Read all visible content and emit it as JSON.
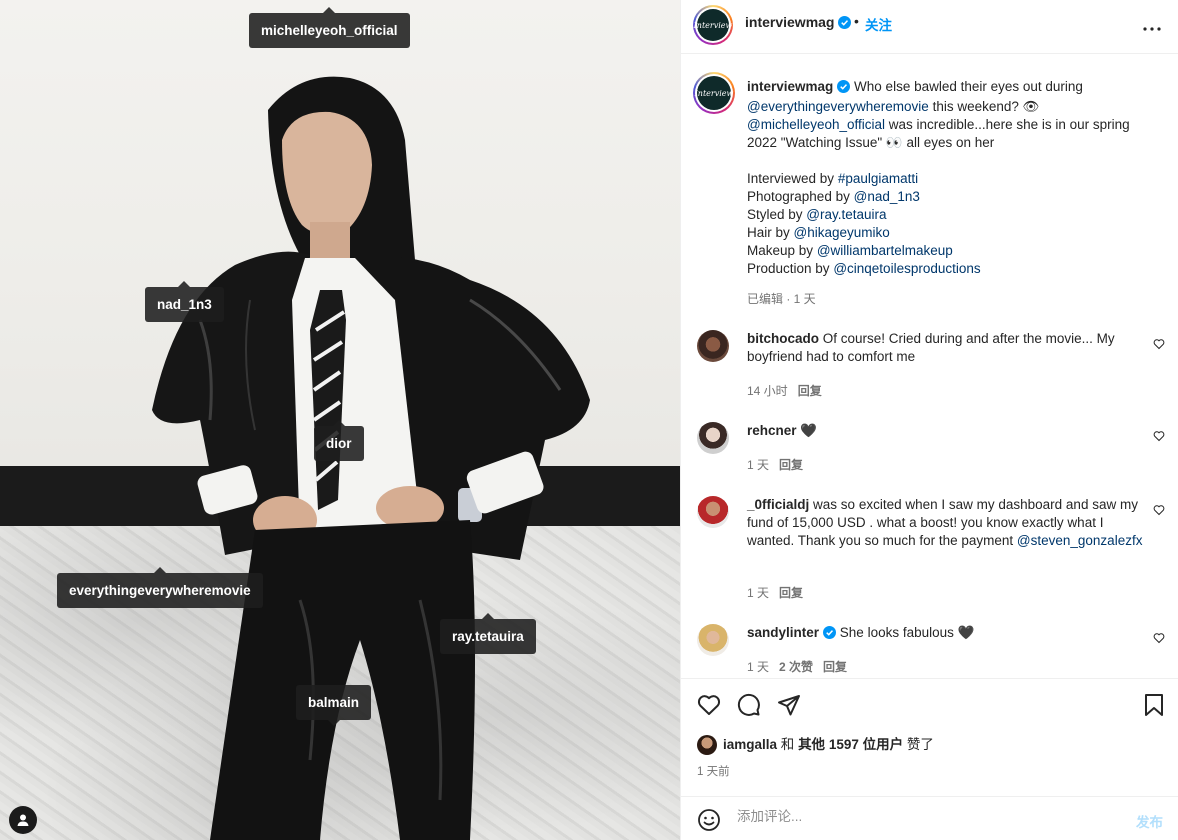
{
  "photo": {
    "tags": [
      {
        "label": "michelleyeoh_official"
      },
      {
        "label": "nad_1n3"
      },
      {
        "label": "dior"
      },
      {
        "label": "everythingeverywheremovie"
      },
      {
        "label": "ray.tetauira"
      },
      {
        "label": "balmain"
      }
    ],
    "user_tags_icon": "person-icon"
  },
  "header": {
    "account": "interviewmag",
    "avatar_text": "Interview",
    "dot": "•",
    "follow_label": "关注",
    "more_icon": "more-horizontal-icon"
  },
  "caption": {
    "username": "interviewmag",
    "line1_text": "Who else bawled their eyes out during",
    "mention_movie": "@everythingeverywheremovie",
    "line2_text": "this weekend? 👁",
    "mention_star": "@michelleyeoh_official",
    "line3_text": "was incredible...here she is in our spring 2022 \"Watching Issue\" 👀 all eyes on her",
    "credits": [
      {
        "role": "Interviewed by",
        "handle": "#paulgiamatti"
      },
      {
        "role": "Photographed by",
        "handle": "@nad_1n3"
      },
      {
        "role": "Styled by",
        "handle": "@ray.tetauira"
      },
      {
        "role": "Hair by",
        "handle": "@hikageyumiko"
      },
      {
        "role": "Makeup by",
        "handle": "@williambartelmakeup"
      },
      {
        "role": "Production by",
        "handle": "@cinqetoilesproductions"
      }
    ],
    "meta": "已编辑 · 1 天"
  },
  "comments": [
    {
      "username": "bitchocado",
      "text": "Of course! Cried during and after the movie... My boyfriend had to comfort me",
      "time": "14 小时",
      "reply": "回复"
    },
    {
      "username": "rehcner",
      "text": "🖤",
      "time": "1 天",
      "reply": "回复"
    },
    {
      "username": "_0fficialdj",
      "text": "was so excited when I saw my dashboard and saw my fund of 15,000 USD . what a boost! you know exactly what I wanted. Thank you so much for the payment",
      "mention": "@steven_gonzalezfx",
      "time": "1 天",
      "reply": "回复"
    },
    {
      "username": "sandylinter",
      "text": "She looks fabulous 🖤",
      "time": "1 天",
      "likes": "2 次赞",
      "reply": "回复"
    }
  ],
  "likes": {
    "first_user": "iamgalla",
    "connector": "和",
    "others": "其他 1597 位用户",
    "suffix": "赞了"
  },
  "time_ago": "1 天前",
  "add_comment": {
    "placeholder": "添加评论...",
    "post_label": "发布"
  },
  "colors": {
    "link": "#00376b",
    "accent": "#0095f6",
    "muted": "#737373",
    "post_disabled": "#b2dffc"
  }
}
